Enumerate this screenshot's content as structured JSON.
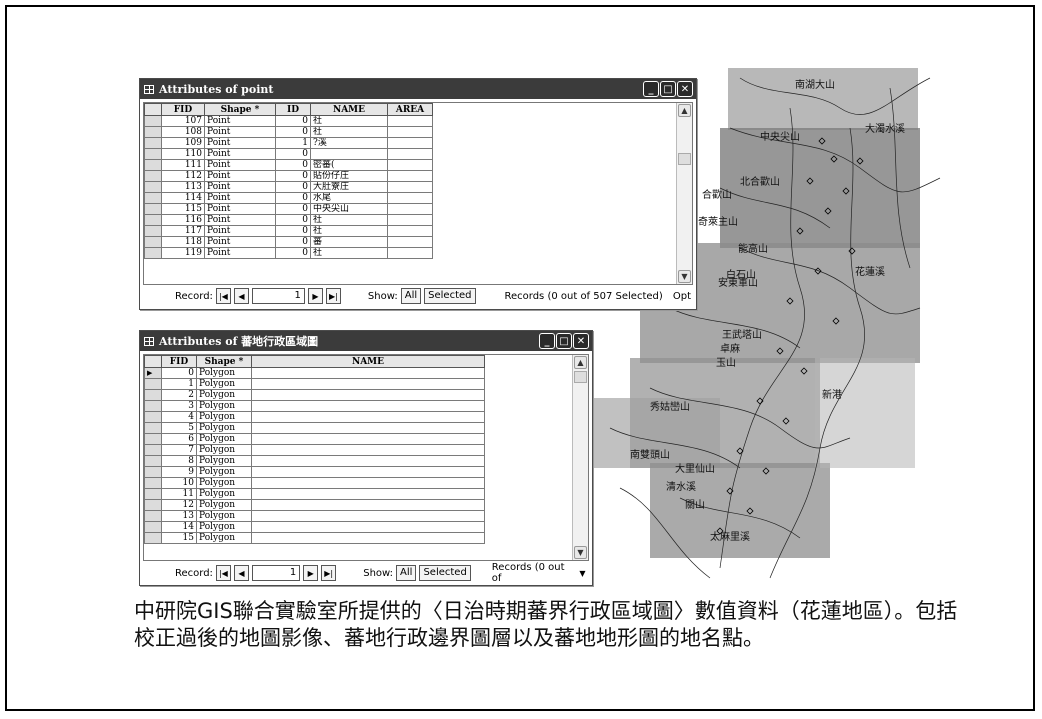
{
  "window1": {
    "title": "Attributes of point",
    "columns": [
      "FID",
      "Shape *",
      "ID",
      "NAME",
      "AREA"
    ],
    "rows": [
      [
        "107",
        "Point",
        "0",
        "社",
        ""
      ],
      [
        "108",
        "Point",
        "0",
        "社",
        ""
      ],
      [
        "109",
        "Point",
        "1",
        "?溪",
        ""
      ],
      [
        "110",
        "Point",
        "0",
        "",
        ""
      ],
      [
        "111",
        "Point",
        "0",
        "密蕃(",
        ""
      ],
      [
        "112",
        "Point",
        "0",
        "貼份仔庄",
        ""
      ],
      [
        "113",
        "Point",
        "0",
        "大肚寮庄",
        ""
      ],
      [
        "114",
        "Point",
        "0",
        "水尾",
        ""
      ],
      [
        "115",
        "Point",
        "0",
        "中央尖山",
        ""
      ],
      [
        "116",
        "Point",
        "0",
        "社",
        ""
      ],
      [
        "117",
        "Point",
        "0",
        "社",
        ""
      ],
      [
        "118",
        "Point",
        "0",
        "蕃",
        ""
      ],
      [
        "119",
        "Point",
        "0",
        "社",
        ""
      ]
    ],
    "record_label": "Record:",
    "record_value": "1",
    "show_label": "Show:",
    "all_label": "All",
    "selected_label": "Selected",
    "records_text": "Records (0 out of 507 Selected)",
    "options_label": "Opt"
  },
  "window2": {
    "title": "Attributes of 蕃地行政區域圖",
    "columns": [
      "FID",
      "Shape *",
      "NAME"
    ],
    "rows": [
      [
        "0",
        "Polygon",
        ""
      ],
      [
        "1",
        "Polygon",
        ""
      ],
      [
        "2",
        "Polygon",
        ""
      ],
      [
        "3",
        "Polygon",
        ""
      ],
      [
        "4",
        "Polygon",
        ""
      ],
      [
        "5",
        "Polygon",
        ""
      ],
      [
        "6",
        "Polygon",
        ""
      ],
      [
        "7",
        "Polygon",
        ""
      ],
      [
        "8",
        "Polygon",
        ""
      ],
      [
        "9",
        "Polygon",
        ""
      ],
      [
        "10",
        "Polygon",
        ""
      ],
      [
        "11",
        "Polygon",
        ""
      ],
      [
        "12",
        "Polygon",
        ""
      ],
      [
        "13",
        "Polygon",
        ""
      ],
      [
        "14",
        "Polygon",
        ""
      ],
      [
        "15",
        "Polygon",
        ""
      ]
    ],
    "record_label": "Record:",
    "record_value": "1",
    "show_label": "Show:",
    "all_label": "All",
    "selected_label": "Selected",
    "records_text": "Records (0 out of"
  },
  "map_labels": [
    "南湖大山",
    "中央尖山",
    "大濁水溪",
    "合歡山",
    "奇萊主山",
    "北合歡山",
    "能高山",
    "白石山",
    "安東軍山",
    "花蓮溪",
    "王武塔山",
    "卓麻",
    "玉山",
    "秀姑巒山",
    "南雙頭山",
    "大里仙山",
    "清水溪",
    "關山",
    "新港",
    "太麻里溪"
  ],
  "caption": "中研院GIS聯合實驗室所提供的〈日治時期蕃界行政區域圖〉數值資料（花蓮地區）。包括校正過後的地圖影像、蕃地行政邊界圖層以及蕃地地形圖的地名點。"
}
